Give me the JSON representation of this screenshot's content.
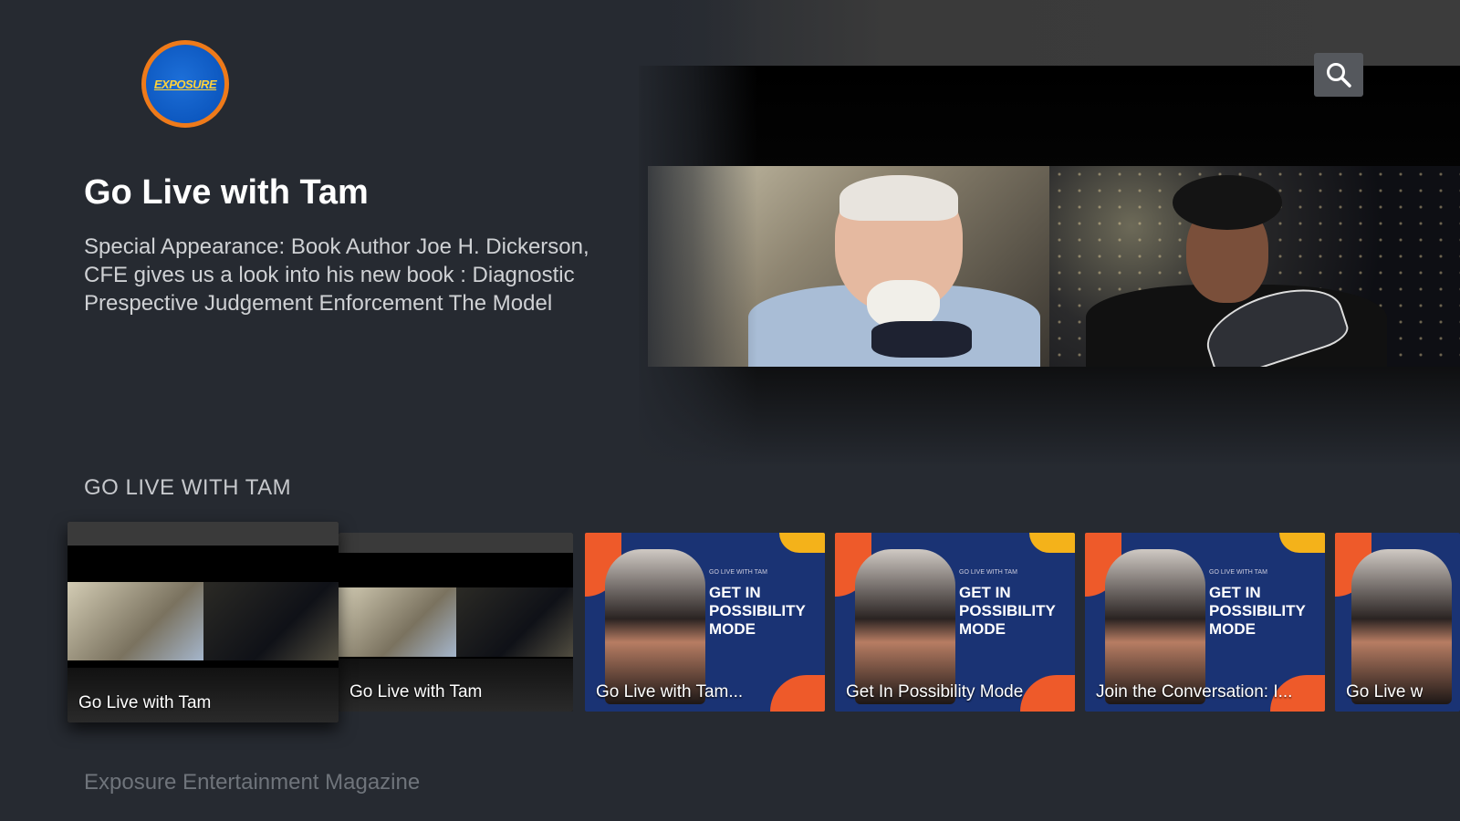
{
  "brand": {
    "logo_text": "EXPOSURE",
    "colors": {
      "logo_ring": "#ee7a1a",
      "logo_fill": "#0d58c0",
      "background": "#262a31"
    }
  },
  "header": {
    "search_icon": "search-icon"
  },
  "hero": {
    "title": "Go Live with Tam",
    "description": "Special Appearance: Book Author Joe H. Dickerson, CFE gives us a look into his new book : Diagnostic Prespective Judgement Enforcement The Model"
  },
  "row": {
    "title": "GO LIVE WITH TAM",
    "cards": [
      {
        "label": "Go Live with Tam",
        "type": "video",
        "focused": true
      },
      {
        "label": "Go Live with Tam",
        "type": "video",
        "focused": false
      },
      {
        "label": "Go Live with Tam...",
        "type": "promo",
        "headline": "GET IN POSSIBILITY MODE",
        "small": "GO LIVE WITH TAM"
      },
      {
        "label": "Get In Possibility Mode",
        "type": "promo",
        "headline": "GET IN POSSIBILITY MODE",
        "small": "GO LIVE WITH TAM"
      },
      {
        "label": "Join the Conversation: I...",
        "type": "promo",
        "headline": "GET IN POSSIBILITY MODE",
        "small": "GO LIVE WITH TAM"
      },
      {
        "label": "Go Live w",
        "type": "promo",
        "headline": "",
        "small": ""
      }
    ]
  },
  "next_row": {
    "title": "Exposure Entertainment Magazine"
  }
}
